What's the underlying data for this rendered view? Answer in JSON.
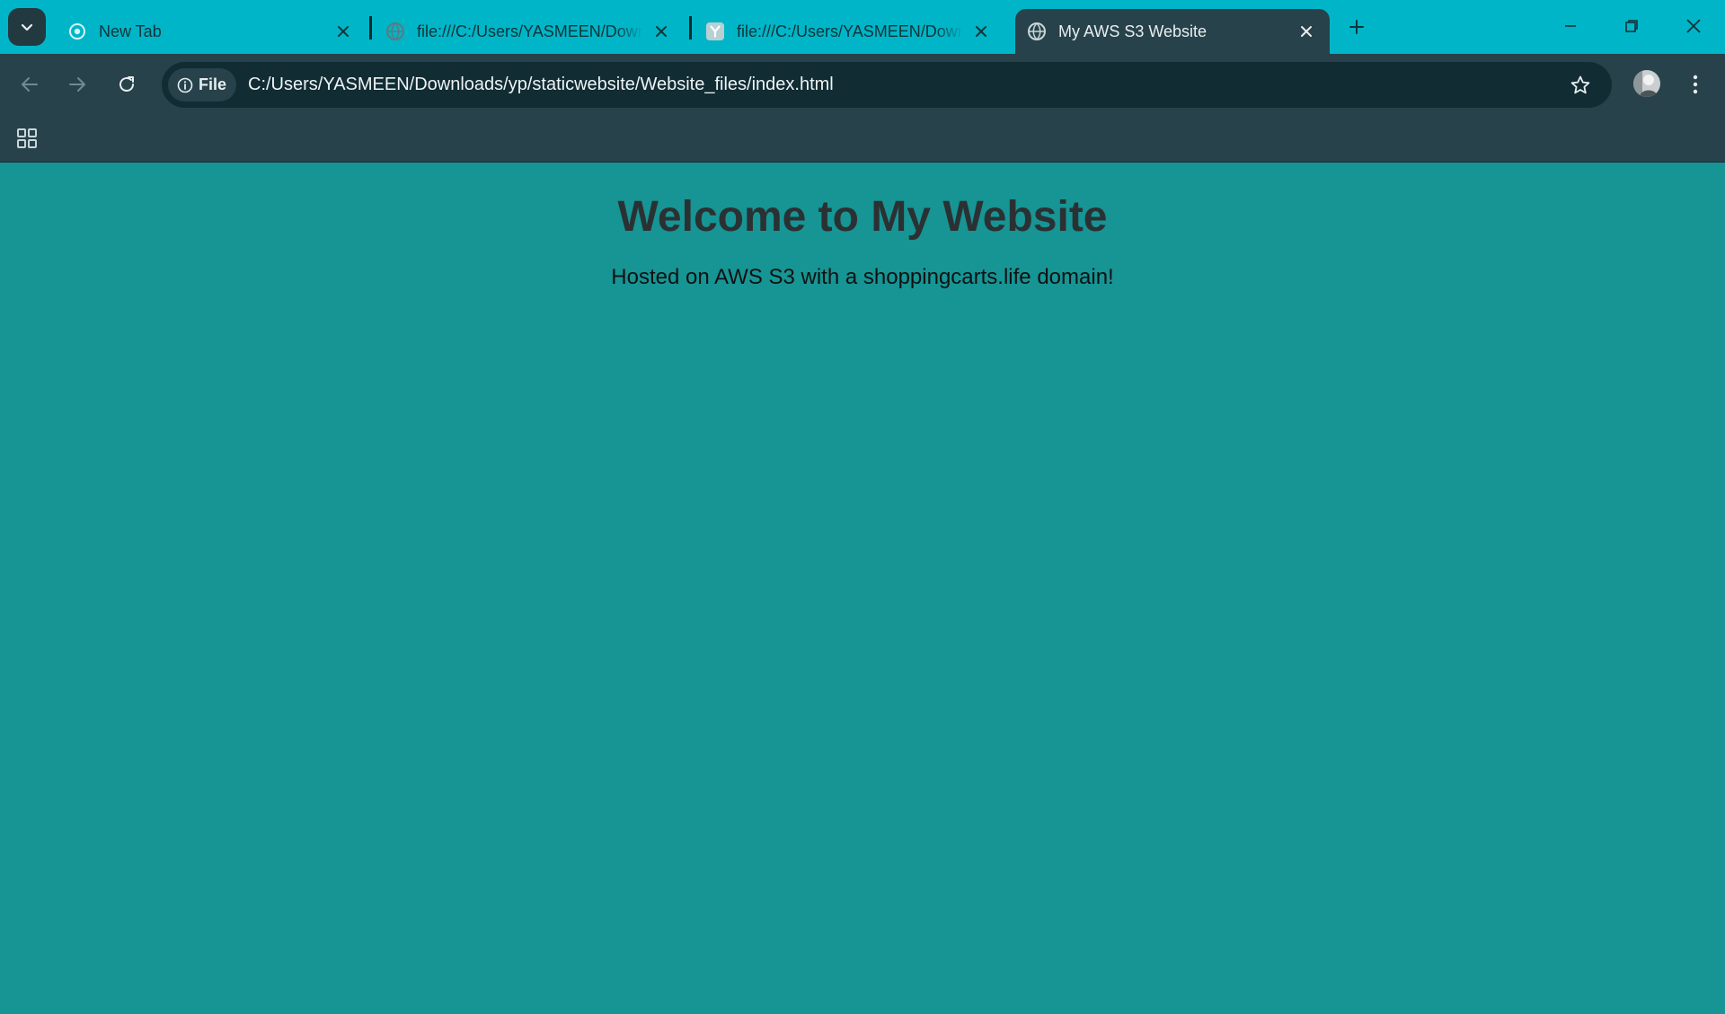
{
  "browser": {
    "tabs": [
      {
        "title": "New Tab",
        "favicon": "chrome-icon",
        "active": false
      },
      {
        "title": "file:///C:/Users/YASMEEN/Downloads/yp/staticwebsite",
        "favicon": "globe-icon",
        "active": false
      },
      {
        "title": "file:///C:/Users/YASMEEN/Downloads/yp/staticwebsite",
        "favicon": "y-app-icon",
        "active": false
      },
      {
        "title": "My AWS S3 Website",
        "favicon": "globe-icon",
        "active": true
      }
    ],
    "omnibox": {
      "chip_label": "File",
      "url": "C:/Users/YASMEEN/Downloads/yp/staticwebsite/Website_files/index.html"
    },
    "colors": {
      "tab_strip": "#00b5c7",
      "toolbar": "#27424a",
      "omnibox": "#112c33",
      "page_background": "#179494"
    }
  },
  "page": {
    "heading": "Welcome to My Website",
    "subtitle": "Hosted on AWS S3 with a shoppingcarts.life domain!"
  }
}
